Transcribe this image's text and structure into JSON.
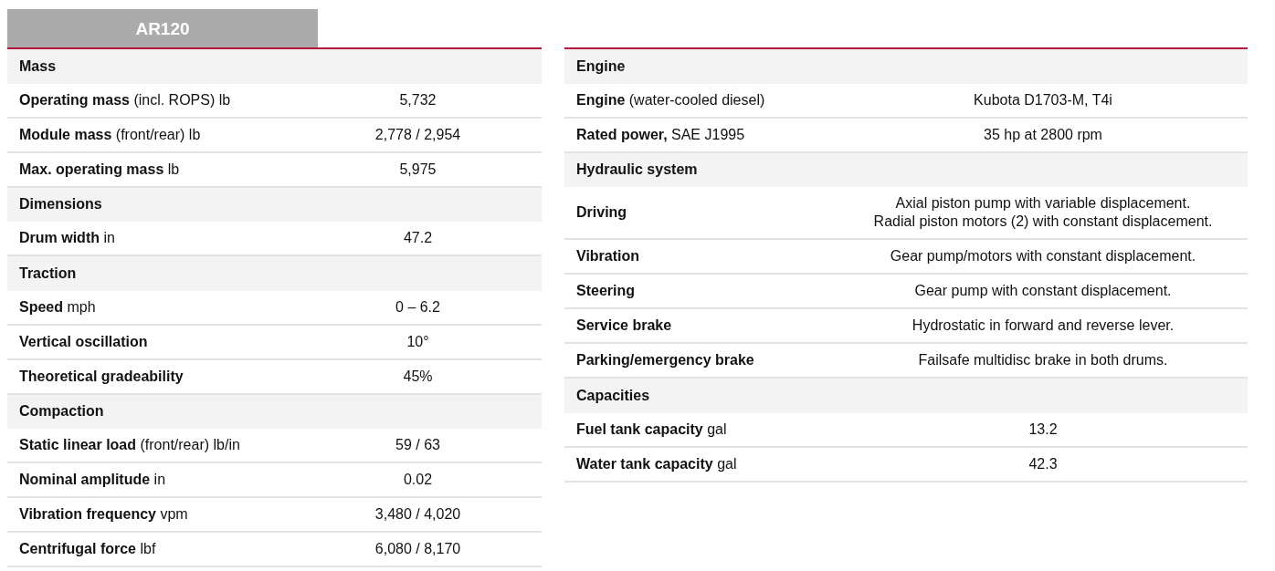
{
  "model_heading": "AR120",
  "left_table": [
    {
      "kind": "section",
      "label": "Mass"
    },
    {
      "kind": "spec",
      "label": "**Operating mass** (incl. ROPS) lb",
      "lines": [
        "5,732"
      ]
    },
    {
      "kind": "spec",
      "label": "**Module mass** (front/rear) lb",
      "lines": [
        "2,778 / 2,954"
      ]
    },
    {
      "kind": "spec",
      "label": "**Max. operating mass** lb",
      "lines": [
        "5,975"
      ]
    },
    {
      "kind": "section",
      "label": "Dimensions"
    },
    {
      "kind": "spec",
      "label": "**Drum width** in",
      "lines": [
        "47.2"
      ]
    },
    {
      "kind": "section",
      "label": "Traction"
    },
    {
      "kind": "spec",
      "label": "**Speed** mph",
      "lines": [
        "0 – 6.2"
      ]
    },
    {
      "kind": "spec",
      "label": "**Vertical oscillation**",
      "lines": [
        "10°"
      ]
    },
    {
      "kind": "spec",
      "label": "**Theoretical gradeability**",
      "lines": [
        "45%"
      ]
    },
    {
      "kind": "section",
      "label": "Compaction"
    },
    {
      "kind": "spec",
      "label": "**Static linear load** (front/rear) lb/in",
      "lines": [
        "59 / 63"
      ]
    },
    {
      "kind": "spec",
      "label": "**Nominal amplitude** in",
      "lines": [
        "0.02"
      ]
    },
    {
      "kind": "spec",
      "label": "**Vibration frequency** vpm",
      "lines": [
        "3,480 / 4,020"
      ]
    },
    {
      "kind": "spec",
      "label": "**Centrifugal force** lbf",
      "lines": [
        "6,080 / 8,170"
      ]
    }
  ],
  "right_table": [
    {
      "kind": "section",
      "label": "Engine"
    },
    {
      "kind": "spec",
      "label": "**Engine** (water-cooled diesel)",
      "lines": [
        "Kubota D1703-M, T4i"
      ]
    },
    {
      "kind": "spec",
      "label": "**Rated power,** SAE J1995",
      "lines": [
        "35 hp at 2800 rpm"
      ]
    },
    {
      "kind": "section",
      "label": "Hydraulic system"
    },
    {
      "kind": "spec",
      "label": "**Driving**",
      "lines": [
        "Axial piston pump with variable displacement.",
        "Radial piston motors (2) with constant displacement."
      ]
    },
    {
      "kind": "spec",
      "label": "**Vibration**",
      "lines": [
        "Gear pump/motors with constant displacement."
      ]
    },
    {
      "kind": "spec",
      "label": "**Steering**",
      "lines": [
        "Gear pump with constant displacement."
      ]
    },
    {
      "kind": "spec",
      "label": "**Service brake**",
      "lines": [
        "Hydrostatic in forward and reverse lever."
      ]
    },
    {
      "kind": "spec",
      "label": "**Parking/emergency brake**",
      "lines": [
        "Failsafe multidisc brake in both drums."
      ]
    },
    {
      "kind": "section",
      "label": "Capacities"
    },
    {
      "kind": "spec",
      "label": "**Fuel tank capacity** gal",
      "lines": [
        "13.2"
      ]
    },
    {
      "kind": "spec",
      "label": "**Water tank capacity** gal",
      "lines": [
        "42.3"
      ]
    }
  ]
}
